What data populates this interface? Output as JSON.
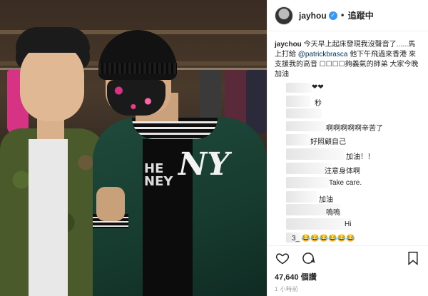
{
  "post": {
    "username": "jayhou",
    "follow_label": "追蹤中",
    "caption_user": "jaychou",
    "caption_text_1": "今天早上起床發現我沒聲音了......馬上打給",
    "caption_mention": "@patrickbrasca",
    "caption_text_2": "他下午飛過來香港 來支援我的高音 ☐☐☐☐夠義氣的師弟 大家今晚加油",
    "likes": "47,640 個讚",
    "time": "1 小時前"
  },
  "photo": {
    "shirt_text": "HE\nNEY",
    "logo_text": "NY"
  },
  "comments": [
    {
      "text": "❤❤"
    },
    {
      "text": "秒"
    },
    {
      "text": "啊啊啊啊啊辛苦了"
    },
    {
      "text": "好照顧自己"
    },
    {
      "text": "加油！！"
    },
    {
      "text": "注意身体啊"
    },
    {
      "text": "Take care."
    },
    {
      "text": "加油"
    },
    {
      "text": "嗚嗚"
    },
    {
      "text": "Hi"
    },
    {
      "text": "3_ 😂😂😂😂😂😂"
    }
  ]
}
